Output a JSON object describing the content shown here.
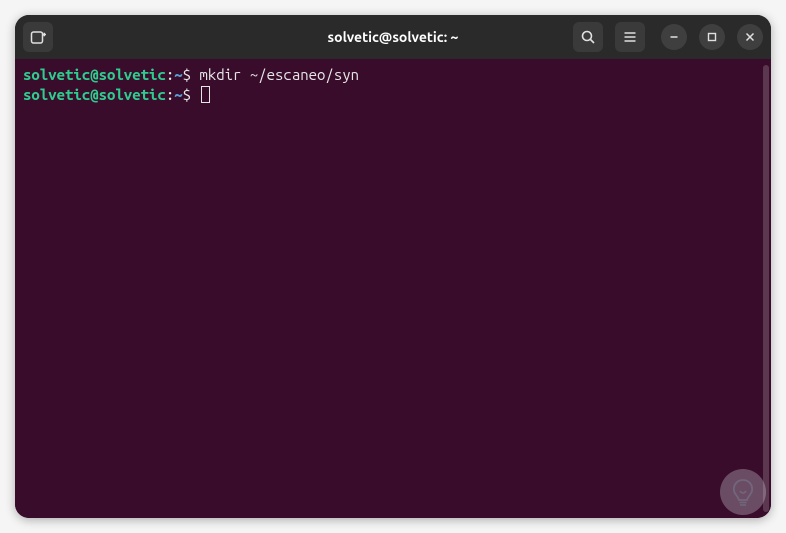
{
  "titlebar": {
    "title": "solvetic@solvetic: ~"
  },
  "terminal": {
    "lines": [
      {
        "user_host": "solvetic@solvetic",
        "colon": ":",
        "path": "~",
        "dollar": "$",
        "command": " mkdir ~/escaneo/syn"
      },
      {
        "user_host": "solvetic@solvetic",
        "colon": ":",
        "path": "~",
        "dollar": "$",
        "command": " "
      }
    ]
  },
  "icons": {
    "new_tab": "new-tab",
    "search": "search",
    "menu": "menu",
    "minimize": "minimize",
    "maximize": "maximize",
    "close": "close"
  }
}
